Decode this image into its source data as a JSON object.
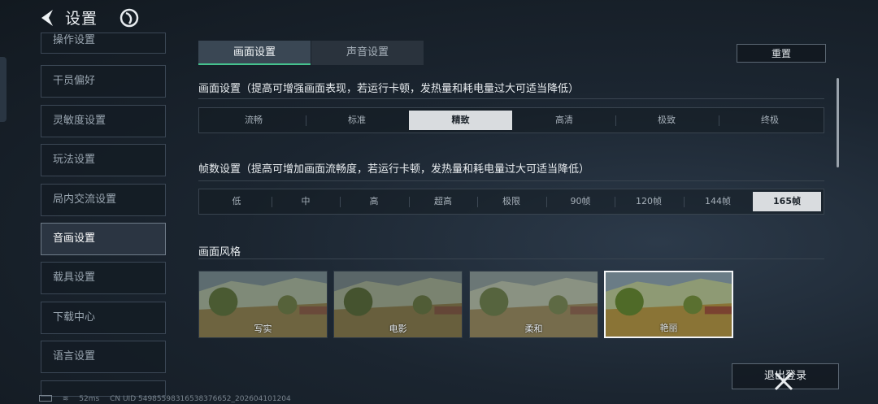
{
  "header": {
    "title": "设置",
    "back_icon": "chevron-left-icon",
    "logo_icon": "brand-logo-icon"
  },
  "sidebar": {
    "items": [
      {
        "label": "操作设置"
      },
      {
        "label": "干员偏好"
      },
      {
        "label": "灵敏度设置"
      },
      {
        "label": "玩法设置"
      },
      {
        "label": "局内交流设置"
      },
      {
        "label": "音画设置",
        "active": true
      },
      {
        "label": "载具设置"
      },
      {
        "label": "下载中心"
      },
      {
        "label": "语言设置"
      }
    ]
  },
  "tabs": [
    {
      "label": "画面设置",
      "active": true
    },
    {
      "label": "声音设置"
    }
  ],
  "reset_label": "重置",
  "graphics_quality": {
    "title": "画面设置（提高可增强画面表现，若运行卡顿，发热量和耗电量过大可适当降低）",
    "options": [
      "流畅",
      "标准",
      "精致",
      "高清",
      "极致",
      "终极"
    ],
    "selected": "精致"
  },
  "frame_rate": {
    "title": "帧数设置（提高可增加画面流畅度，若运行卡顿，发热量和耗电量过大可适当降低）",
    "options": [
      "低",
      "中",
      "高",
      "超高",
      "极限",
      "90帧",
      "120帧",
      "144帧",
      "165帧"
    ],
    "selected": "165帧"
  },
  "style": {
    "title": "画面风格",
    "options": [
      "写实",
      "电影",
      "柔和",
      "艳丽"
    ],
    "selected": "艳丽"
  },
  "logout_label": "退出登录",
  "status_bar": {
    "ping": "52ms",
    "uid": "CN UID 5498559831653837665​2_202604101204"
  },
  "colors": {
    "accent": "#45c28e",
    "selected_bg": "#d9dcdf"
  }
}
